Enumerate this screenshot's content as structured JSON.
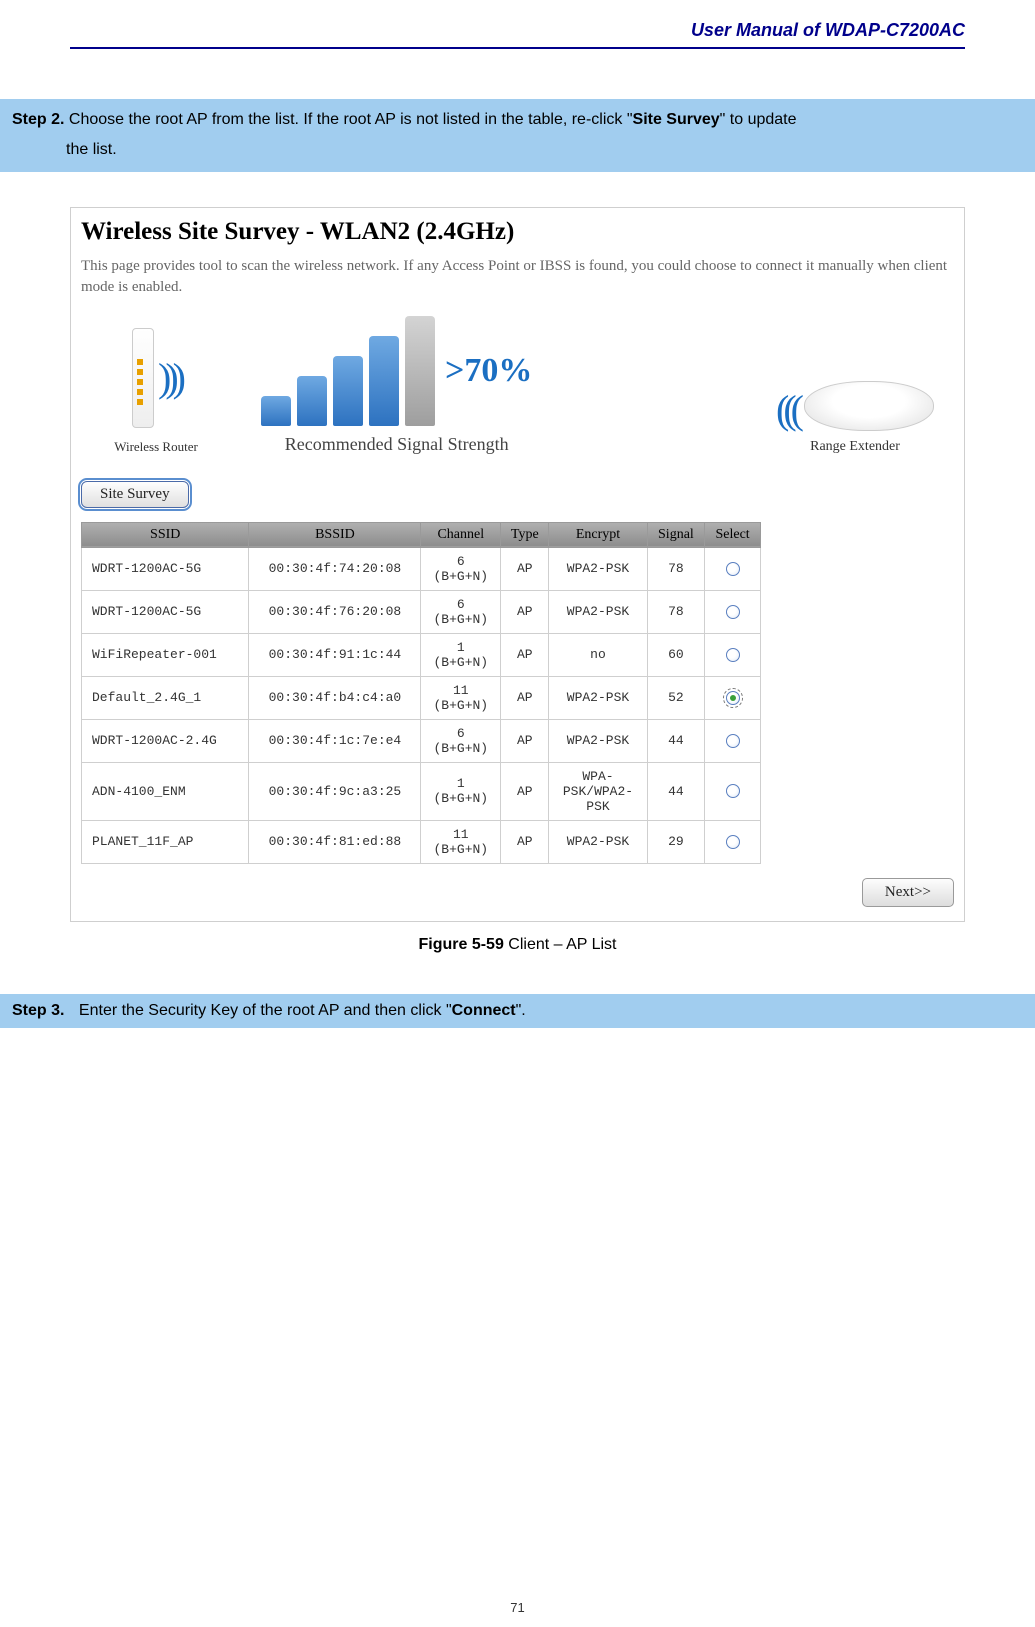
{
  "header": {
    "title": "User Manual of WDAP-C7200AC"
  },
  "step2": {
    "label": "Step 2.",
    "text_a": "Choose the root AP from the list. If the root AP is not listed in the table, re-click \"",
    "bold": "Site Survey",
    "text_b": "\" to update",
    "text_c": "the list."
  },
  "figure": {
    "title": "Wireless Site Survey - WLAN2 (2.4GHz)",
    "desc": "This page provides tool to scan the wireless network. If any Access Point or IBSS is found, you could choose to connect it manually when client mode is enabled.",
    "router_label": "Wireless Router",
    "signal_pct": ">70%",
    "signal_label": "Recommended Signal Strength",
    "extender_label": "Range Extender",
    "survey_btn": "Site Survey",
    "next_btn": "Next>>"
  },
  "table": {
    "headers": [
      "SSID",
      "BSSID",
      "Channel",
      "Type",
      "Encrypt",
      "Signal",
      "Select"
    ],
    "rows": [
      {
        "ssid": "WDRT-1200AC-5G",
        "bssid": "00:30:4f:74:20:08",
        "channel": "6\n(B+G+N)",
        "type": "AP",
        "encrypt": "WPA2-PSK",
        "signal": "78",
        "selected": false
      },
      {
        "ssid": "WDRT-1200AC-5G",
        "bssid": "00:30:4f:76:20:08",
        "channel": "6\n(B+G+N)",
        "type": "AP",
        "encrypt": "WPA2-PSK",
        "signal": "78",
        "selected": false
      },
      {
        "ssid": "WiFiRepeater-001",
        "bssid": "00:30:4f:91:1c:44",
        "channel": "1\n(B+G+N)",
        "type": "AP",
        "encrypt": "no",
        "signal": "60",
        "selected": false
      },
      {
        "ssid": "Default_2.4G_1",
        "bssid": "00:30:4f:b4:c4:a0",
        "channel": "11\n(B+G+N)",
        "type": "AP",
        "encrypt": "WPA2-PSK",
        "signal": "52",
        "selected": true
      },
      {
        "ssid": "WDRT-1200AC-2.4G",
        "bssid": "00:30:4f:1c:7e:e4",
        "channel": "6\n(B+G+N)",
        "type": "AP",
        "encrypt": "WPA2-PSK",
        "signal": "44",
        "selected": false
      },
      {
        "ssid": "ADN-4100_ENM",
        "bssid": "00:30:4f:9c:a3:25",
        "channel": "1\n(B+G+N)",
        "type": "AP",
        "encrypt": "WPA-PSK/WPA2-PSK",
        "signal": "44",
        "selected": false
      },
      {
        "ssid": "PLANET_11F_AP",
        "bssid": "00:30:4f:81:ed:88",
        "channel": "11\n(B+G+N)",
        "type": "AP",
        "encrypt": "WPA2-PSK",
        "signal": "29",
        "selected": false
      }
    ]
  },
  "caption": {
    "bold": "Figure 5-59",
    "rest": " Client – AP List"
  },
  "step3": {
    "label": "Step 3.",
    "text_a": "Enter the Security Key of the root AP and then click \"",
    "bold": "Connect",
    "text_b": "\"."
  },
  "page_number": "71"
}
